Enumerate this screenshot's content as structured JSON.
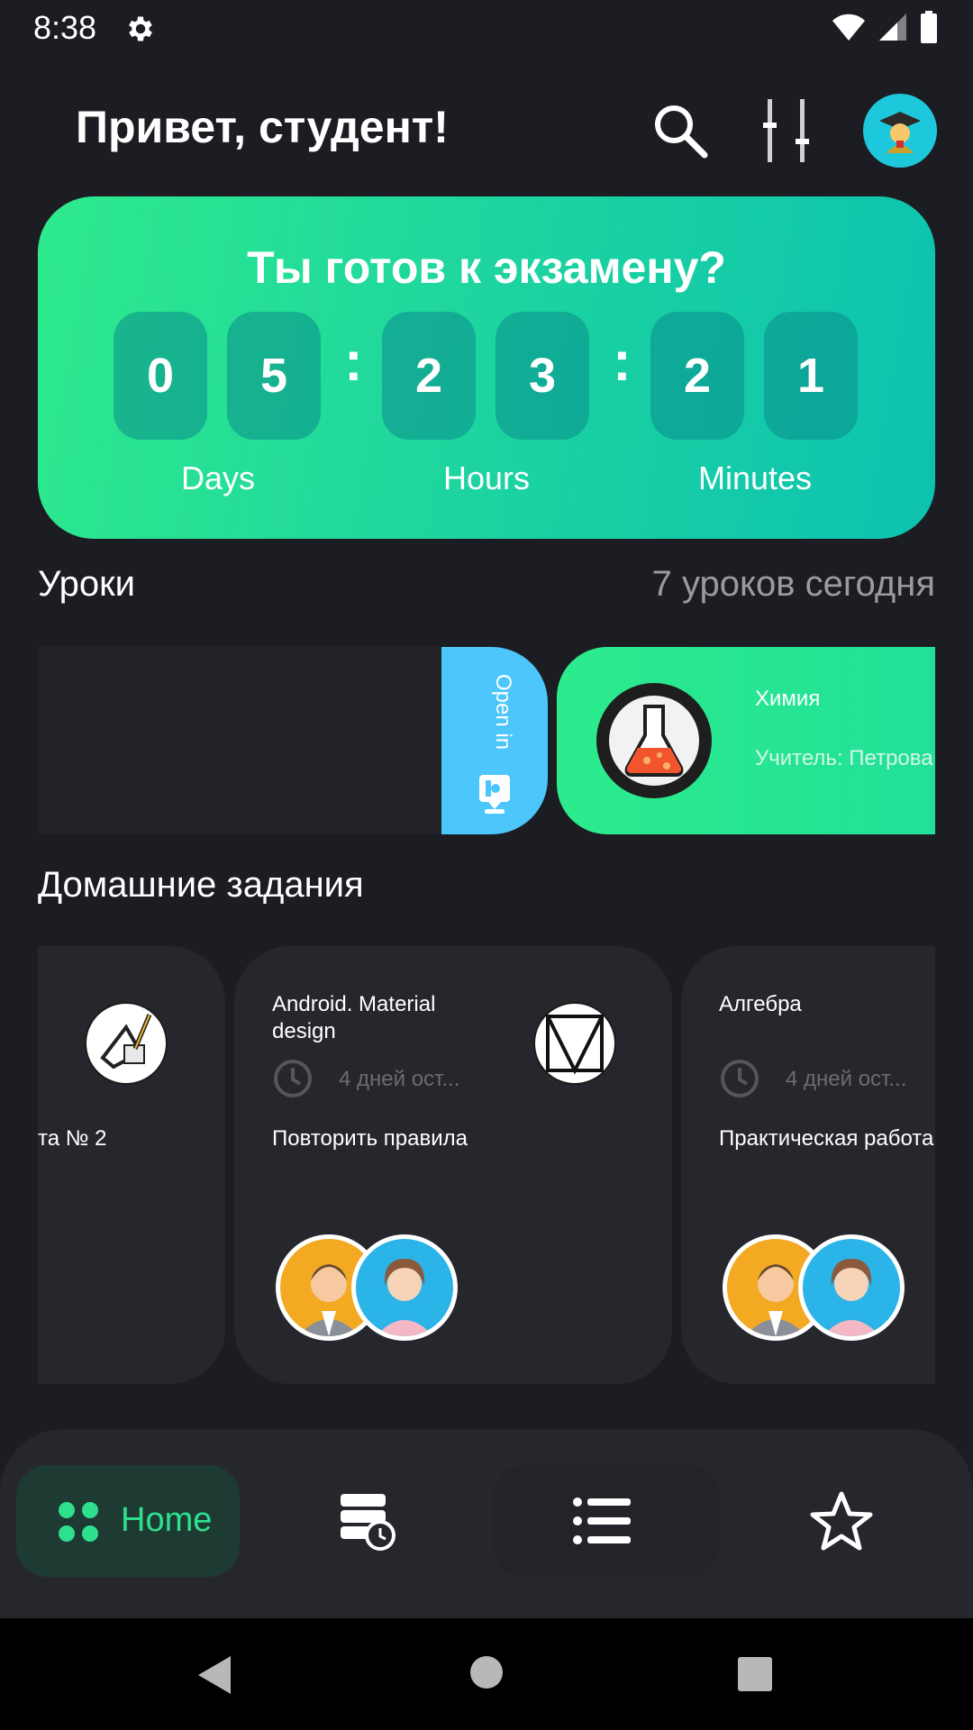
{
  "status_bar": {
    "time": "8:38",
    "icons": [
      "settings-gear-icon",
      "wifi-icon",
      "signal-icon",
      "battery-icon"
    ]
  },
  "header": {
    "greeting": "Привет, студент!",
    "icons": [
      "search-icon",
      "filter-sliders-icon",
      "student-avatar"
    ]
  },
  "exam_countdown": {
    "title": "Ты готов к экзамену?",
    "digits": {
      "days": [
        "0",
        "5"
      ],
      "hours": [
        "2",
        "3"
      ],
      "minutes": [
        "2",
        "1"
      ]
    },
    "separator": ":",
    "labels": {
      "days": "Days",
      "hours": "Hours",
      "minutes": "Minutes"
    }
  },
  "lessons": {
    "title": "Уроки",
    "count_text": "7 уроков сегодня",
    "open_in_label": "Open in",
    "current": {
      "subject": "Химия",
      "teacher": "Учитель: Петрова"
    }
  },
  "homework": {
    "title": "Домашние задания",
    "cards": [
      {
        "title": "",
        "deadline": "",
        "task": "та № 2"
      },
      {
        "title": "Android. Material design",
        "deadline": "4 дней ост...",
        "task": "Повторить правила"
      },
      {
        "title": "Алгебра",
        "deadline": "4 дней ост...",
        "task": "Практическая работа"
      }
    ]
  },
  "bottom_nav": {
    "items": [
      {
        "label": "Home",
        "icon": "home-dots-icon",
        "active": true
      },
      {
        "label": "",
        "icon": "schedule-icon",
        "active": false
      },
      {
        "label": "",
        "icon": "list-icon",
        "active": false
      },
      {
        "label": "",
        "icon": "star-icon",
        "active": false
      }
    ]
  },
  "colors": {
    "accent": "#2ee08e",
    "background": "#1c1d22",
    "card": "#26272d",
    "open_in": "#4cc6fb"
  }
}
